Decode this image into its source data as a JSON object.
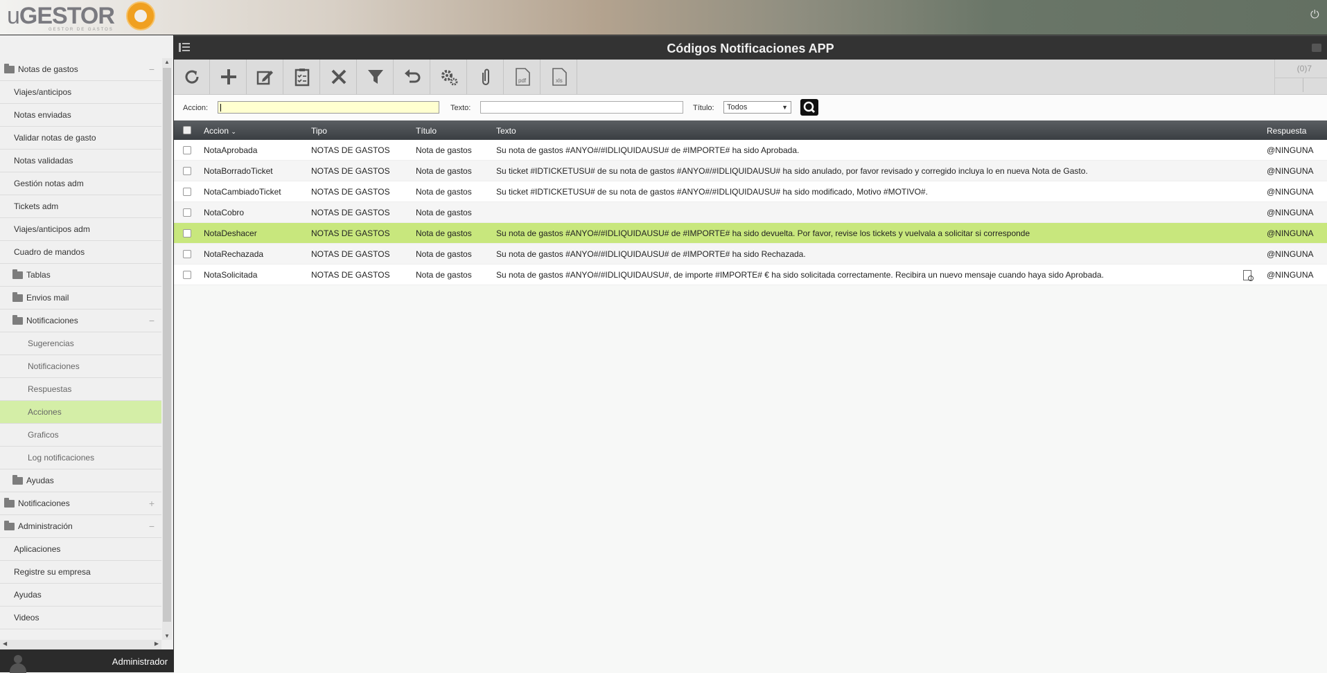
{
  "app": {
    "logo_prefix": "u",
    "logo_text": "GESTOR",
    "logo_sub": "GESTOR DE GASTOS",
    "page_title": "Códigos Notificaciones APP"
  },
  "sidebar": {
    "items": [
      {
        "label": "Notas de gastos",
        "sign": "−"
      },
      {
        "label": "Viajes/anticipos"
      },
      {
        "label": "Notas enviadas"
      },
      {
        "label": "Validar notas de gasto"
      },
      {
        "label": "Notas validadas"
      },
      {
        "label": "Gestión notas adm"
      },
      {
        "label": "Tickets adm"
      },
      {
        "label": "Viajes/anticipos adm"
      },
      {
        "label": "Cuadro de mandos"
      },
      {
        "label": "Tablas"
      },
      {
        "label": "Envios mail"
      },
      {
        "label": "Notificaciones",
        "sign": "−"
      },
      {
        "label": "Sugerencias"
      },
      {
        "label": "Notificaciones"
      },
      {
        "label": "Respuestas"
      },
      {
        "label": "Acciones"
      },
      {
        "label": "Graficos"
      },
      {
        "label": "Log notificaciones"
      },
      {
        "label": "Ayudas"
      },
      {
        "label": "Notificaciones",
        "sign": "+"
      },
      {
        "label": "Administración",
        "sign": "−"
      },
      {
        "label": "Aplicaciones"
      },
      {
        "label": "Registre su empresa"
      },
      {
        "label": "Ayudas"
      },
      {
        "label": "Videos"
      }
    ],
    "user": "Administrador"
  },
  "toolbar": {
    "counter": "(0)7",
    "buttons": [
      "refresh-icon",
      "add-icon",
      "edit-icon",
      "clipboard-check-icon",
      "delete-icon",
      "filter-icon",
      "undo-icon",
      "settings-icon",
      "attachment-icon",
      "pdf-icon",
      "xls-icon"
    ],
    "pdf_label": "pdf",
    "xls_label": "xls"
  },
  "filter": {
    "accion_label": "Accion:",
    "accion_value": "",
    "texto_label": "Texto:",
    "texto_value": "",
    "titulo_label": "Título:",
    "titulo_value": "Todos"
  },
  "table": {
    "headers": {
      "accion": "Accion",
      "tipo": "Tipo",
      "titulo": "Título",
      "texto": "Texto",
      "respuesta": "Respuesta"
    },
    "rows": [
      {
        "accion": "NotaAprobada",
        "tipo": "NOTAS DE GASTOS",
        "titulo": "Nota de gastos",
        "texto": "Su nota de gastos #ANYO#/#IDLIQUIDAUSU# de #IMPORTE# ha sido Aprobada.",
        "respuesta": "@NINGUNA"
      },
      {
        "accion": "NotaBorradoTicket",
        "tipo": "NOTAS DE GASTOS",
        "titulo": "Nota de gastos",
        "texto": "Su ticket #IDTICKETUSU# de su nota de gastos #ANYO#/#IDLIQUIDAUSU# ha sido anulado, por favor revisado y corregido incluya lo en nueva Nota de Gasto.",
        "respuesta": "@NINGUNA"
      },
      {
        "accion": "NotaCambiadoTicket",
        "tipo": "NOTAS DE GASTOS",
        "titulo": "Nota de gastos",
        "texto": "Su ticket #IDTICKETUSU# de su nota de gastos #ANYO#/#IDLIQUIDAUSU# ha sido modificado, Motivo #MOTIVO#.",
        "respuesta": "@NINGUNA"
      },
      {
        "accion": "NotaCobro",
        "tipo": "NOTAS DE GASTOS",
        "titulo": "Nota de gastos",
        "texto": "",
        "respuesta": "@NINGUNA"
      },
      {
        "accion": "NotaDeshacer",
        "tipo": "NOTAS DE GASTOS",
        "titulo": "Nota de gastos",
        "texto": "Su nota de gastos #ANYO#/#IDLIQUIDAUSU# de #IMPORTE# ha sido devuelta. Por favor, revise los tickets y vuelvala a solicitar si corresponde",
        "respuesta": "@NINGUNA"
      },
      {
        "accion": "NotaRechazada",
        "tipo": "NOTAS DE GASTOS",
        "titulo": "Nota de gastos",
        "texto": "Su nota de gastos #ANYO#/#IDLIQUIDAUSU# de #IMPORTE# ha sido Rechazada.",
        "respuesta": "@NINGUNA"
      },
      {
        "accion": "NotaSolicitada",
        "tipo": "NOTAS DE GASTOS",
        "titulo": "Nota de gastos",
        "texto": "Su nota de gastos #ANYO#/#IDLIQUIDAUSU#, de importe #IMPORTE# € ha sido solicitada correctamente. Recibira un nuevo mensaje cuando haya sido Aprobada.",
        "respuesta": "@NINGUNA"
      }
    ]
  },
  "colors": {
    "highlight": "#c8e77d",
    "active_menu": "#d4eea7",
    "logo_orange": "#f0a020"
  }
}
